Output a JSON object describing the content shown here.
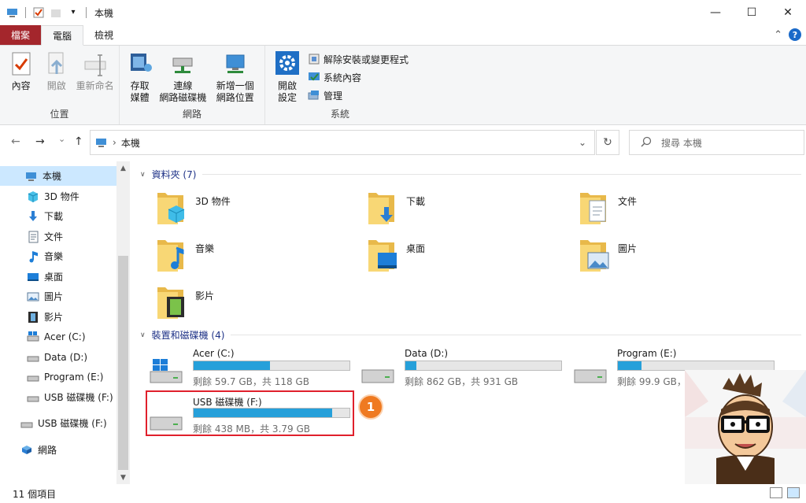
{
  "window": {
    "title": "本機",
    "minimize": "—",
    "maximize": "☐",
    "close": "✕"
  },
  "tabs": {
    "file": "檔案",
    "computer": "電腦",
    "view": "檢視",
    "collapse": "⌃",
    "help": "?"
  },
  "ribbon": {
    "location": {
      "label": "位置",
      "properties": "內容",
      "open": "開啟",
      "rename": "重新命名"
    },
    "network": {
      "label": "網路",
      "media_line1": "存取",
      "media_line2": "媒體",
      "map_line1": "連線",
      "map_line2": "網路磁碟機",
      "add_line1": "新增一個",
      "add_line2": "網路位置"
    },
    "system": {
      "label": "系統",
      "settings_line1": "開啟",
      "settings_line2": "設定",
      "uninstall": "解除安裝或變更程式",
      "sysprops": "系統內容",
      "manage": "管理"
    }
  },
  "address": {
    "path": "本機",
    "back": "←",
    "forward": "→",
    "recent": "⌄",
    "up": "↑",
    "refresh": "↻",
    "dropdown": "⌄",
    "search_placeholder": "搜尋 本機"
  },
  "nav": {
    "items": [
      {
        "label": "本機"
      },
      {
        "label": "3D 物件"
      },
      {
        "label": "下載"
      },
      {
        "label": "文件"
      },
      {
        "label": "音樂"
      },
      {
        "label": "桌面"
      },
      {
        "label": "圖片"
      },
      {
        "label": "影片"
      },
      {
        "label": "Acer (C:)"
      },
      {
        "label": "Data (D:)"
      },
      {
        "label": "Program (E:)"
      },
      {
        "label": "USB 磁碟機 (F:)"
      },
      {
        "label": "USB 磁碟機 (F:)"
      },
      {
        "label": "網路"
      }
    ]
  },
  "folders_section": {
    "header": "資料夾 (7)",
    "items": [
      {
        "name": "3D 物件"
      },
      {
        "name": "下載"
      },
      {
        "name": "文件"
      },
      {
        "name": "音樂"
      },
      {
        "name": "桌面"
      },
      {
        "name": "圖片"
      },
      {
        "name": "影片"
      }
    ]
  },
  "drives_section": {
    "header": "裝置和磁碟機 (4)",
    "items": [
      {
        "name": "Acer (C:)",
        "size": "剩餘 59.7 GB，共 118 GB",
        "used_fraction": 0.49
      },
      {
        "name": "Data (D:)",
        "size": "剩餘 862 GB，共 931 GB",
        "used_fraction": 0.07
      },
      {
        "name": "Program (E:)",
        "size": "剩餘 99.9 GB，共 118 GB",
        "used_fraction": 0.15
      },
      {
        "name": "USB 磁碟機 (F:)",
        "size": "剩餘 438 MB，共 3.79 GB",
        "used_fraction": 0.89
      }
    ]
  },
  "annotation": {
    "badge": "1"
  },
  "status": {
    "count": "11 個項目"
  },
  "colors": {
    "accent": "#26a0da",
    "file_tab": "#a4262c",
    "highlight": "#e0202c",
    "badge": "#ef7a21"
  }
}
